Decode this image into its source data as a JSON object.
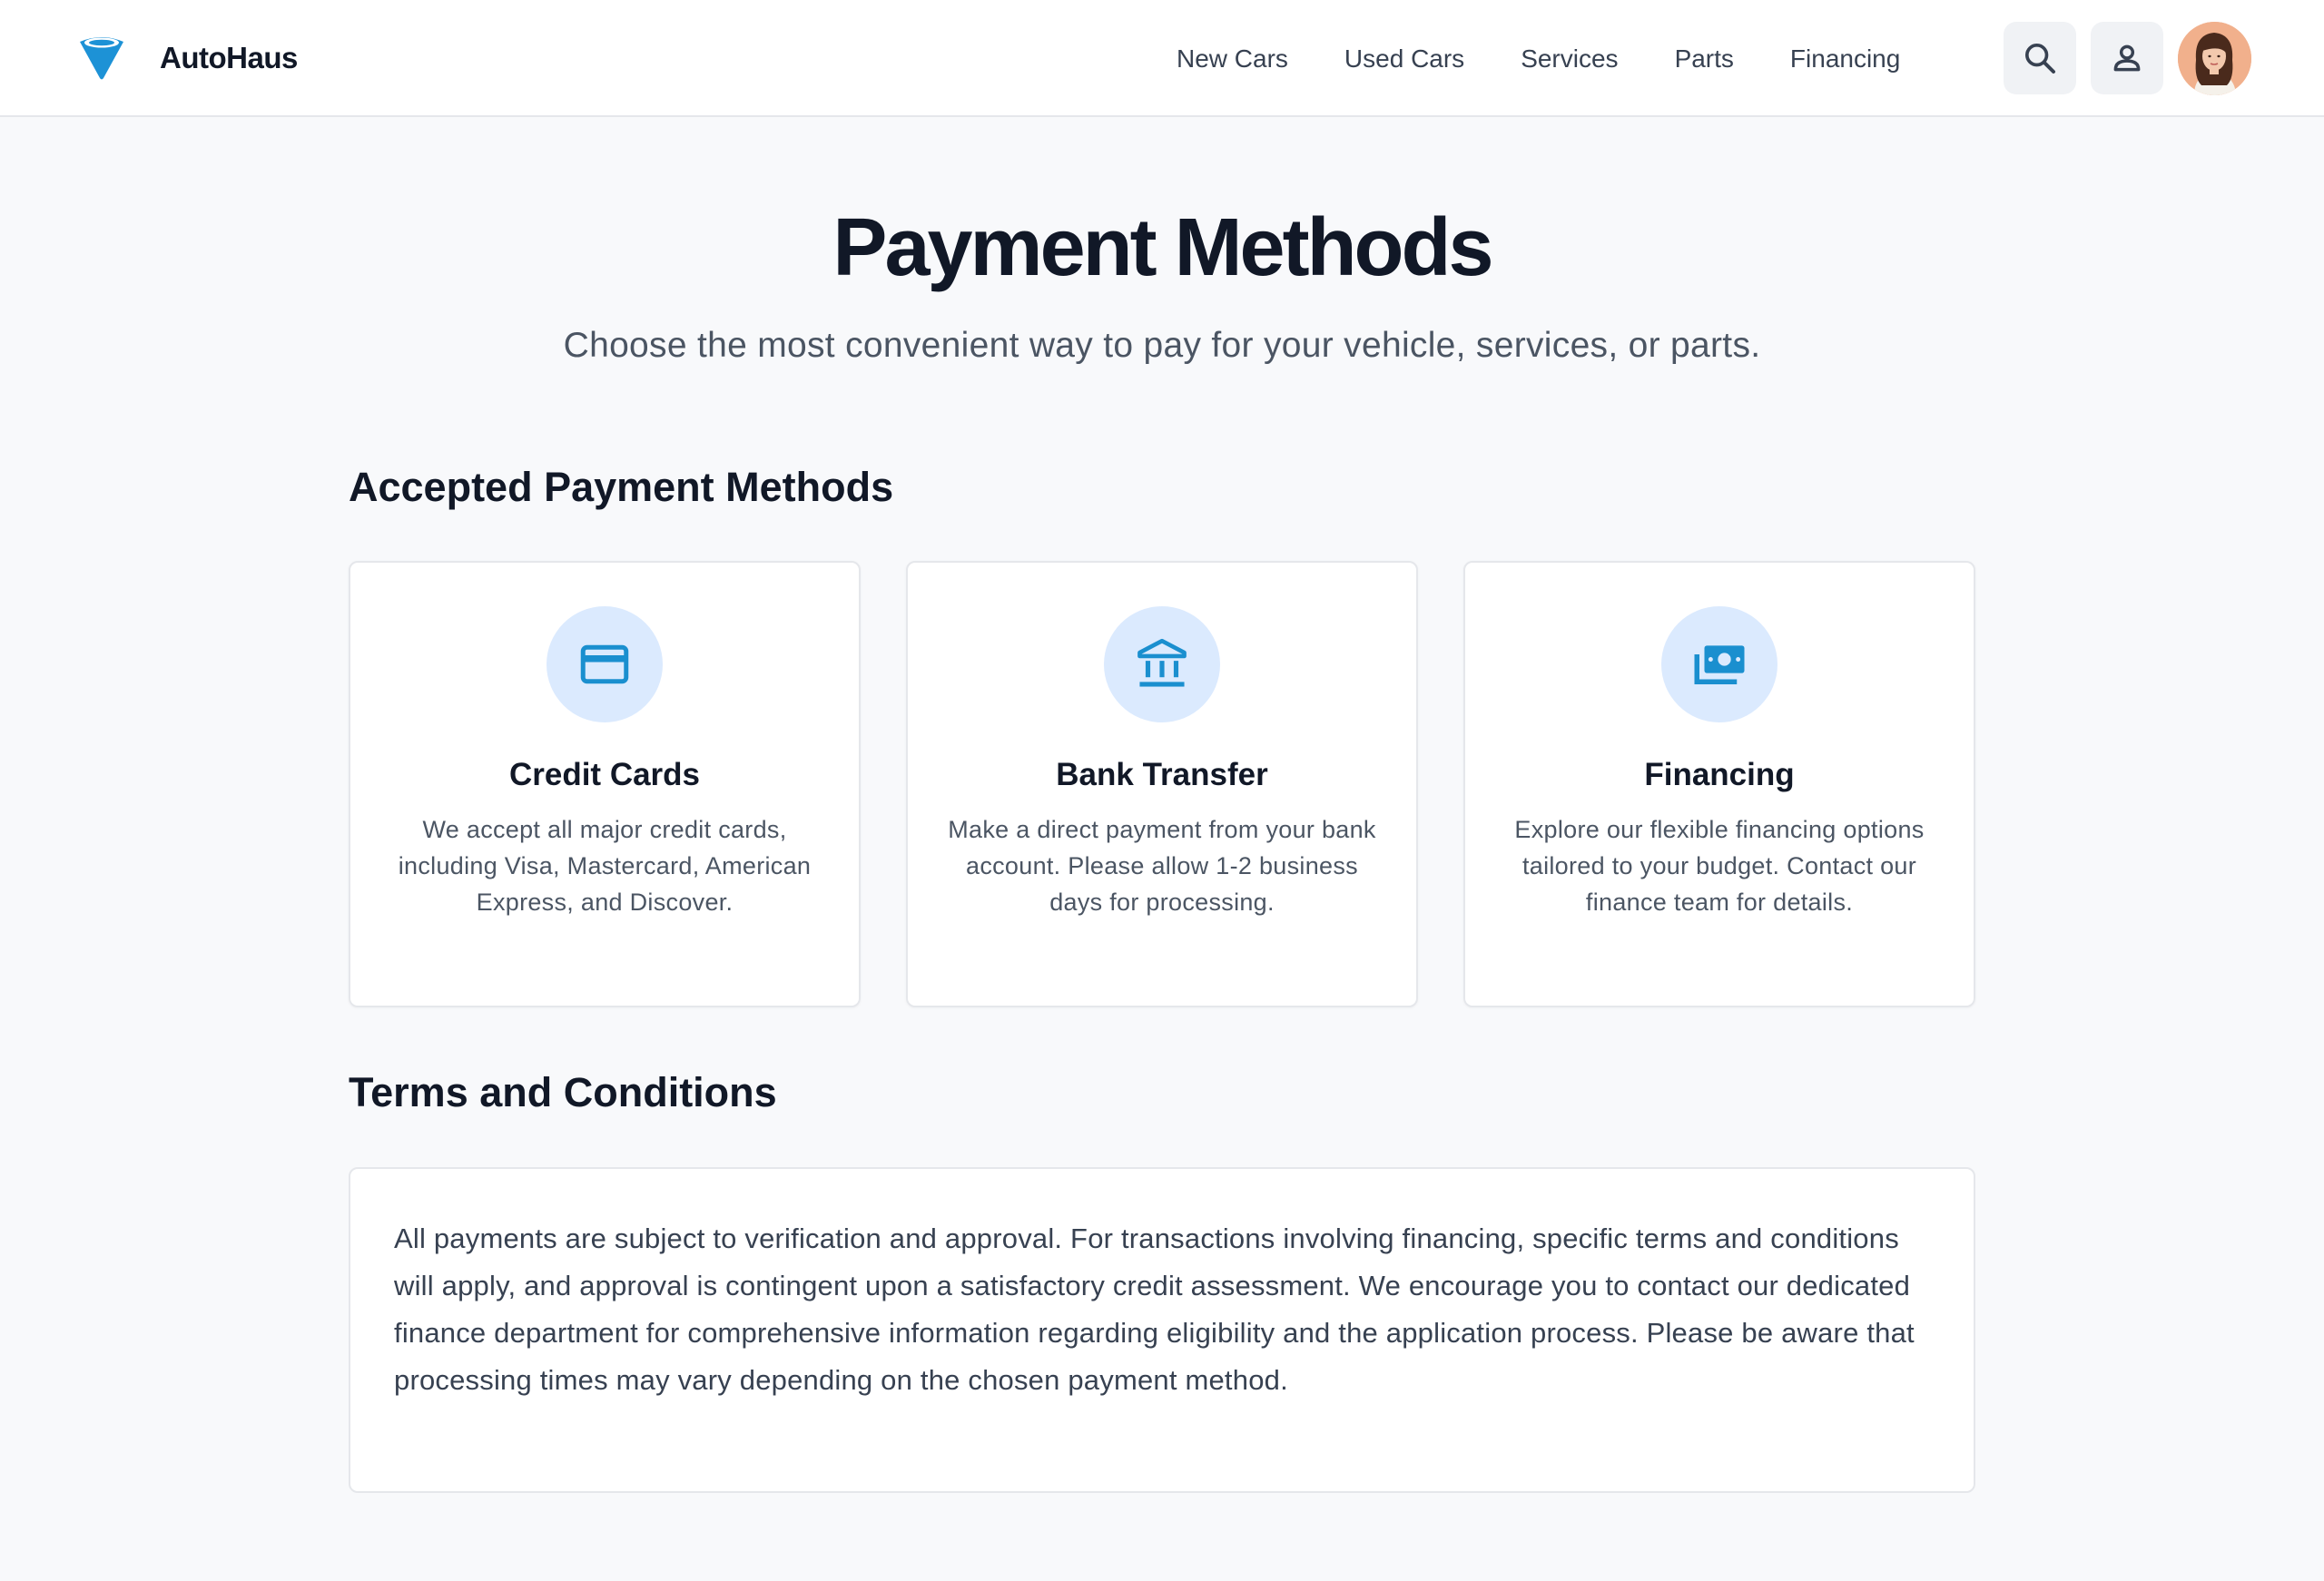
{
  "header": {
    "brand_name": "AutoHaus",
    "brand_color": "#0ea5e9",
    "nav": [
      {
        "label": "New Cars"
      },
      {
        "label": "Used Cars"
      },
      {
        "label": "Services"
      },
      {
        "label": "Parts"
      },
      {
        "label": "Financing"
      }
    ],
    "search_icon": "search-icon",
    "account_icon": "user-icon",
    "avatar_icon": "user-avatar"
  },
  "hero": {
    "title": "Payment Methods",
    "subtitle": "Choose the most convenient way to pay for your vehicle, services, or parts."
  },
  "methods": {
    "heading": "Accepted Payment Methods",
    "accent_color": "#1a8fcf",
    "icon_bg_color": "#dbeafe",
    "cards": [
      {
        "icon": "credit-card-icon",
        "title": "Credit Cards",
        "description": "We accept all major credit cards, including Visa, Mastercard, American Express, and Discover."
      },
      {
        "icon": "bank-icon",
        "title": "Bank Transfer",
        "description": "Make a direct payment from your bank account. Please allow 1-2 business days for processing."
      },
      {
        "icon": "money-icon",
        "title": "Financing",
        "description": "Explore our flexible financing options tailored to your budget. Contact our finance team for details."
      }
    ]
  },
  "terms": {
    "heading": "Terms and Conditions",
    "text": "All payments are subject to verification and approval. For transactions involving financing, specific terms and conditions will apply, and approval is contingent upon a satisfactory credit assessment. We encourage you to contact our dedicated finance department for comprehensive information regarding eligibility and the application process. Please be aware that processing times may vary depending on the chosen payment method."
  }
}
